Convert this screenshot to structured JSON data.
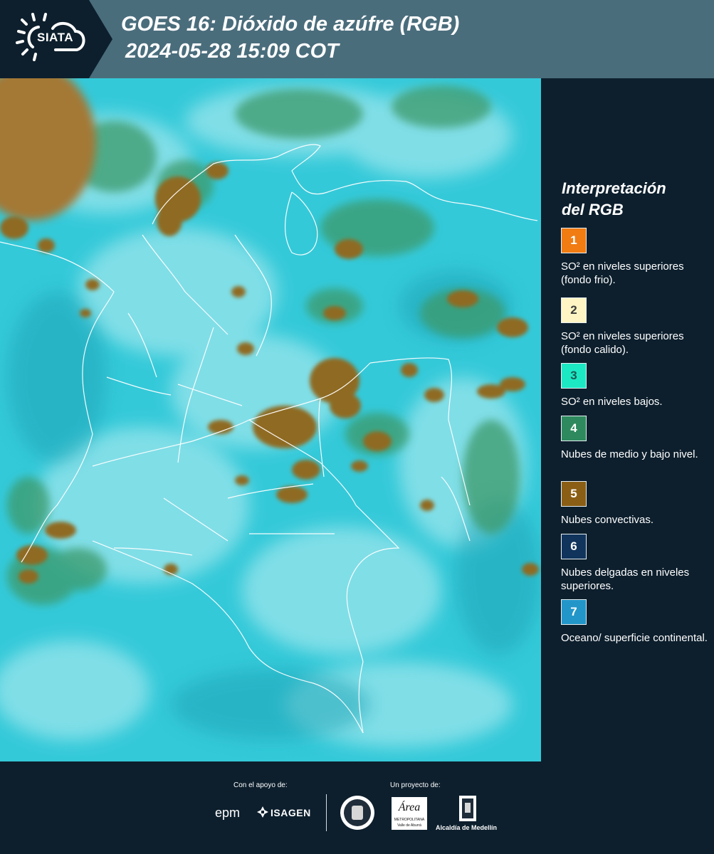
{
  "header": {
    "logo_text": "SIATA",
    "title": "GOES 16: Dióxido de azúfre (RGB)",
    "subtitle": "2024-05-28 15:09 COT"
  },
  "legend": {
    "title_line1": "Interpretación",
    "title_line2": "del RGB",
    "items": [
      {
        "number": "1",
        "color": "#f07c12",
        "text": "SO² en niveles superiores (fondo frio)."
      },
      {
        "number": "2",
        "color": "#fff5c4",
        "text": "SO² en niveles superiores (fondo calido)."
      },
      {
        "number": "3",
        "color": "#1ce8c4",
        "text": "SO² en niveles bajos."
      },
      {
        "number": "4",
        "color": "#2e8a5e",
        "text": "Nubes de medio y bajo nivel."
      },
      {
        "number": "5",
        "color": "#8a5e14",
        "text": "Nubes convectivas."
      },
      {
        "number": "6",
        "color": "#10345c",
        "text": "Nubes delgadas en niveles superiores."
      },
      {
        "number": "7",
        "color": "#2296c8",
        "text": "Oceano/ superficie continental."
      }
    ]
  },
  "footer": {
    "support_label": "Con el apoyo de:",
    "project_label": "Un proyecto de:",
    "logo_epm": "epm",
    "logo_isagen": "ISAGEN",
    "logo_area": "Área",
    "logo_area_sub": "METROPOLITANA",
    "logo_area_sub2": "Valle de Aburrá",
    "logo_alcaldia": "Alcaldía de Medellín"
  },
  "colors": {
    "background": "#0d1f2d",
    "header": "#4a6d7c",
    "map_base": "#2fc8d8",
    "cloud_convective": "#8a6a1e",
    "cloud_mid": "#3f9a6a"
  }
}
